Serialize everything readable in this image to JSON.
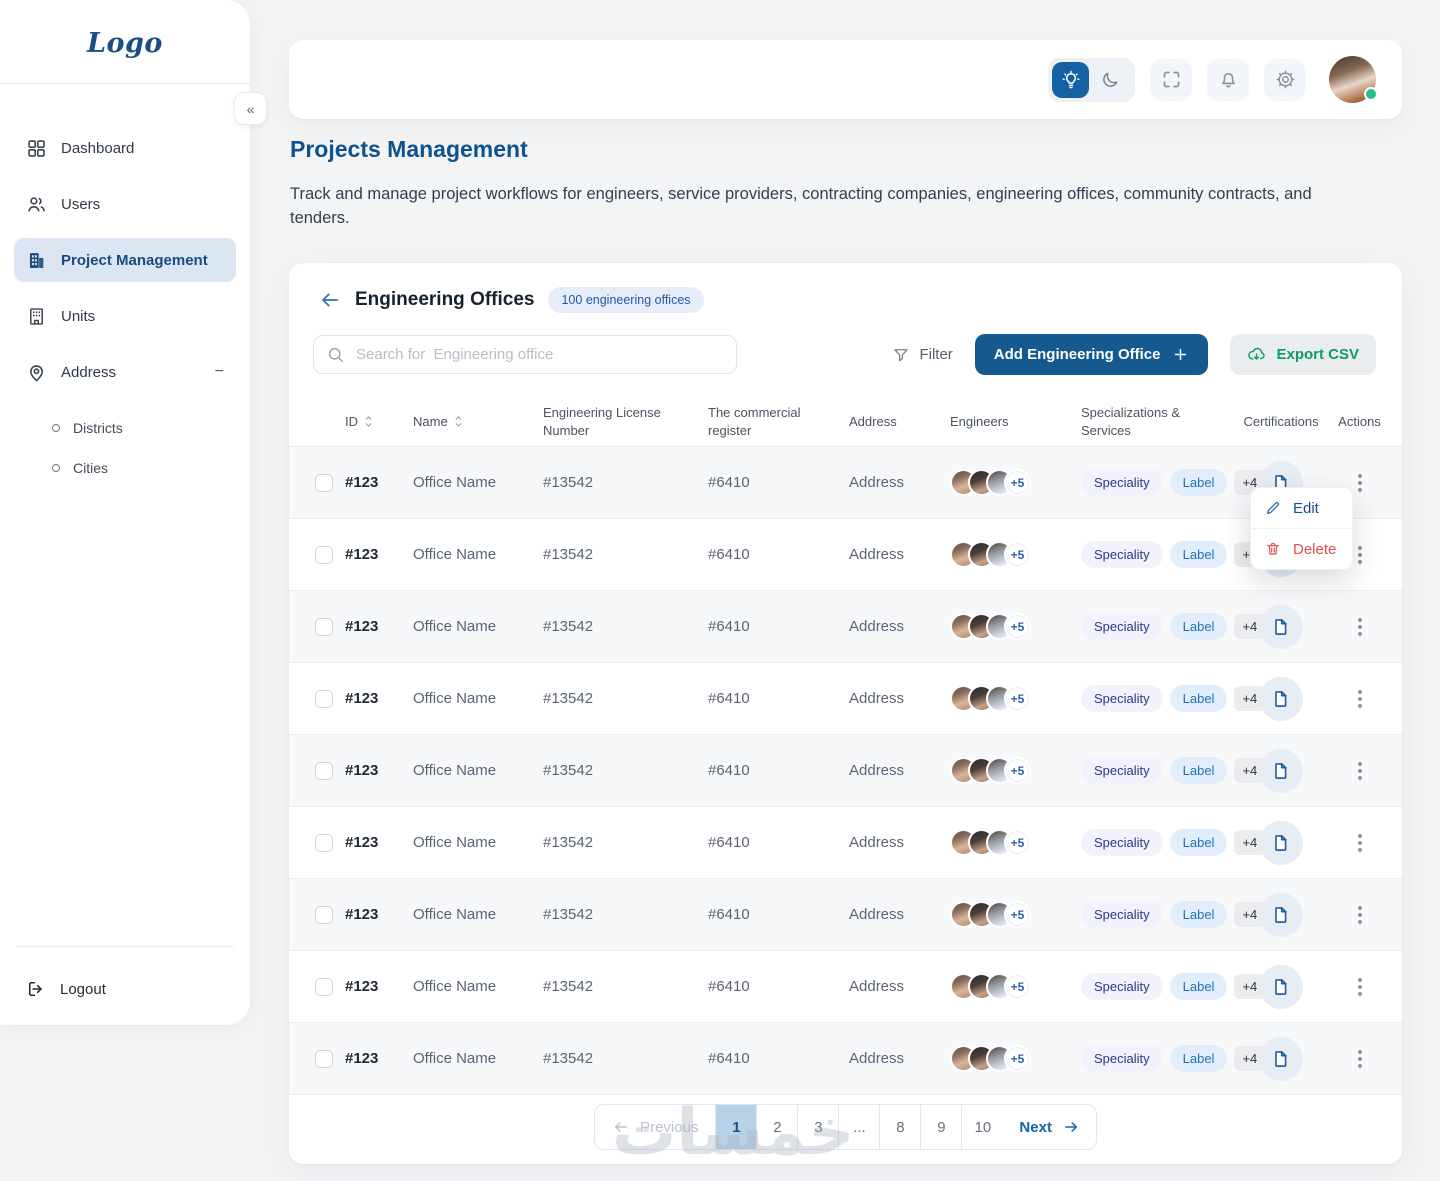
{
  "sidebar": {
    "logo": "Logo",
    "collapse_icon": "«",
    "items": [
      {
        "label": "Dashboard",
        "icon": "grid-icon",
        "active": false
      },
      {
        "label": "Users",
        "icon": "users-icon",
        "active": false
      },
      {
        "label": "Project Management",
        "icon": "building-icon",
        "active": true
      },
      {
        "label": "Units",
        "icon": "units-building-icon",
        "active": false
      },
      {
        "label": "Address",
        "icon": "map-pin-icon",
        "active": false,
        "expanded": true,
        "collapse_indicator": "−",
        "children": [
          "Districts",
          "Cities"
        ]
      }
    ],
    "logout_label": "Logout"
  },
  "topbar": {
    "theme": "light",
    "icons": [
      "lightbulb",
      "moon",
      "fullscreen",
      "bell",
      "gear"
    ],
    "avatar_status": "online"
  },
  "page": {
    "title": "Projects Management",
    "subtitle": "Track and manage project workflows for engineers, service providers, contracting companies, engineering offices, community contracts, and tenders."
  },
  "panel": {
    "title": "Engineering Offices",
    "badge": "100 engineering offices",
    "search_placeholder": "Search for  Engineering office",
    "filter_label": "Filter",
    "add_button_label": "Add Engineering Office",
    "export_button_label": "Export CSV",
    "columns": [
      "ID",
      "Name",
      "Engineering License Number",
      "The commercial register",
      "Address",
      "Engineers",
      "Specializations & Services",
      "Certifications",
      "Actions"
    ],
    "sortable_columns": [
      "ID",
      "Name"
    ],
    "rows": [
      {
        "id": "#123",
        "name": "Office Name",
        "license": "#13542",
        "commercial_register": "#6410",
        "address": "Address",
        "engineers_extra": "+5",
        "tags": [
          "Speciality",
          "Label"
        ],
        "tags_extra": "+4"
      },
      {
        "id": "#123",
        "name": "Office Name",
        "license": "#13542",
        "commercial_register": "#6410",
        "address": "Address",
        "engineers_extra": "+5",
        "tags": [
          "Speciality",
          "Label"
        ],
        "tags_extra": "+4"
      },
      {
        "id": "#123",
        "name": "Office Name",
        "license": "#13542",
        "commercial_register": "#6410",
        "address": "Address",
        "engineers_extra": "+5",
        "tags": [
          "Speciality",
          "Label"
        ],
        "tags_extra": "+4"
      },
      {
        "id": "#123",
        "name": "Office Name",
        "license": "#13542",
        "commercial_register": "#6410",
        "address": "Address",
        "engineers_extra": "+5",
        "tags": [
          "Speciality",
          "Label"
        ],
        "tags_extra": "+4"
      },
      {
        "id": "#123",
        "name": "Office Name",
        "license": "#13542",
        "commercial_register": "#6410",
        "address": "Address",
        "engineers_extra": "+5",
        "tags": [
          "Speciality",
          "Label"
        ],
        "tags_extra": "+4"
      },
      {
        "id": "#123",
        "name": "Office Name",
        "license": "#13542",
        "commercial_register": "#6410",
        "address": "Address",
        "engineers_extra": "+5",
        "tags": [
          "Speciality",
          "Label"
        ],
        "tags_extra": "+4"
      },
      {
        "id": "#123",
        "name": "Office Name",
        "license": "#13542",
        "commercial_register": "#6410",
        "address": "Address",
        "engineers_extra": "+5",
        "tags": [
          "Speciality",
          "Label"
        ],
        "tags_extra": "+4"
      },
      {
        "id": "#123",
        "name": "Office Name",
        "license": "#13542",
        "commercial_register": "#6410",
        "address": "Address",
        "engineers_extra": "+5",
        "tags": [
          "Speciality",
          "Label"
        ],
        "tags_extra": "+4"
      },
      {
        "id": "#123",
        "name": "Office Name",
        "license": "#13542",
        "commercial_register": "#6410",
        "address": "Address",
        "engineers_extra": "+5",
        "tags": [
          "Speciality",
          "Label"
        ],
        "tags_extra": "+4"
      }
    ]
  },
  "context_menu": {
    "items": [
      {
        "label": "Edit",
        "icon": "pencil-icon"
      },
      {
        "label": "Delete",
        "icon": "trash-icon"
      }
    ]
  },
  "pagination": {
    "previous_label": "Previous",
    "pages": [
      "1",
      "2",
      "3",
      "...",
      "8",
      "9",
      "10"
    ],
    "active_page": "1",
    "next_label": "Next"
  },
  "watermark": "خمسات",
  "colors": {
    "brand_blue": "#15598f",
    "title_blue": "#0f528c",
    "active_item_bg": "#dbe6f2",
    "active_page_bg": "#b7d1e8",
    "export_green": "#0e9d63",
    "delete_red": "#e44d49",
    "badge_bg": "#e7edf8",
    "badge_text": "#2059a8",
    "online_green": "#27bd8b"
  }
}
